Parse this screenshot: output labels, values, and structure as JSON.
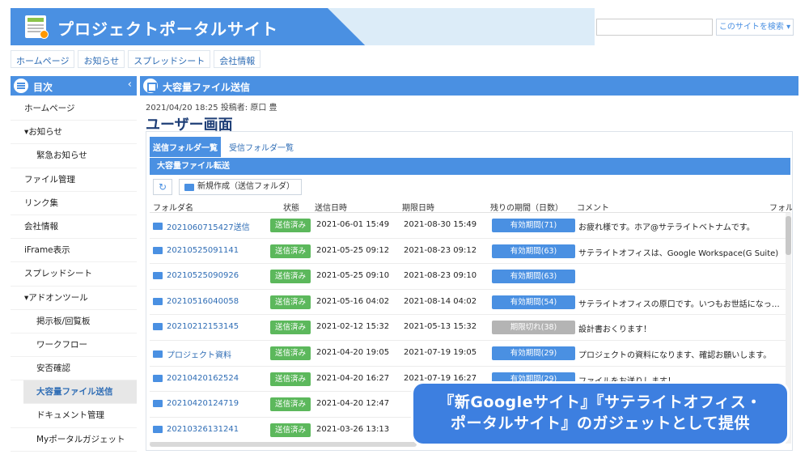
{
  "header": {
    "site_title": "プロジェクトポータルサイト",
    "search_placeholder": "",
    "search_button": "このサイトを検索 ▾",
    "colors": {
      "primary": "#4a90e2",
      "banner_light": "#dcecf8"
    }
  },
  "topnav": [
    "ホームページ",
    "お知らせ",
    "スプレッドシート",
    "会社情報"
  ],
  "sidebar": {
    "title": "目次",
    "collapse_glyph": "‹",
    "items": [
      {
        "label": "ホームページ",
        "level": 0
      },
      {
        "label": "▾お知らせ",
        "level": 0
      },
      {
        "label": "緊急お知らせ",
        "level": 1
      },
      {
        "label": "ファイル管理",
        "level": 0
      },
      {
        "label": "リンク集",
        "level": 0
      },
      {
        "label": "会社情報",
        "level": 0
      },
      {
        "label": "iFrame表示",
        "level": 0
      },
      {
        "label": "スプレッドシート",
        "level": 0
      },
      {
        "label": "▾アドオンツール",
        "level": 0
      },
      {
        "label": "掲示板/回覧板",
        "level": 1
      },
      {
        "label": "ワークフロー",
        "level": 1
      },
      {
        "label": "安否確認",
        "level": 1
      },
      {
        "label": "大容量ファイル送信",
        "level": 1,
        "active": true
      },
      {
        "label": "ドキュメント管理",
        "level": 1
      },
      {
        "label": "Myポータルガジェット",
        "level": 1
      }
    ]
  },
  "main": {
    "title": "大容量ファイル送信",
    "meta": "2021/04/20 18:25 投稿者: 原口 豊",
    "heading": "ユーザー画面",
    "tabs": [
      {
        "label": "送信フォルダ一覧",
        "active": true
      },
      {
        "label": "受信フォルダ一覧",
        "active": false
      }
    ],
    "subhead": "大容量ファイル転送",
    "refresh_glyph": "↻",
    "new_button": "新規作成（送信フォルダ）",
    "columns": {
      "folder": "フォルダ名",
      "status": "状態",
      "sent": "送信日時",
      "limit": "期限日時",
      "remaining": "残りの期間（日数）",
      "comment": "コメント",
      "extra": "フォル"
    },
    "rows": [
      {
        "folder": "20210607154​27送信",
        "status": "送信済み",
        "sent": "2021-06-01 15:49",
        "limit": "2021-08-30 15:49",
        "period": "有効期間(71)",
        "expired": false,
        "comment": "お疲れ様です。ホア@サテライトベトナムです。"
      },
      {
        "folder": "20210525091141",
        "status": "送信済み",
        "sent": "2021-05-25 09:12",
        "limit": "2021-08-23 09:12",
        "period": "有効期間(63)",
        "expired": false,
        "comment": "サテライトオフィスは、Google Workspace(G Suite) …"
      },
      {
        "folder": "20210525090926",
        "status": "送信済み",
        "sent": "2021-05-25 09:10",
        "limit": "2021-08-23 09:10",
        "period": "有効期間(63)",
        "expired": false,
        "comment": ""
      },
      {
        "folder": "20210516040058",
        "status": "送信済み",
        "sent": "2021-05-16 04:02",
        "limit": "2021-08-14 04:02",
        "period": "有効期間(54)",
        "expired": false,
        "comment": "サテライトオフィスの原口です。いつもお世話になっ…"
      },
      {
        "folder": "20210212153145",
        "status": "送信済み",
        "sent": "2021-02-12 15:32",
        "limit": "2021-05-13 15:32",
        "period": "期限切れ(38)",
        "expired": true,
        "comment": "設計書おくります！"
      },
      {
        "folder": "プロジェクト資料",
        "status": "送信済み",
        "sent": "2021-04-20 19:05",
        "limit": "2021-07-19 19:05",
        "period": "有効期間(29)",
        "expired": false,
        "comment": "プロジェクトの資料になります、確認お願いします。"
      },
      {
        "folder": "20210420162524",
        "status": "送信済み",
        "sent": "2021-04-20 16:27",
        "limit": "2021-07-19 16:27",
        "period": "有効期間(29)",
        "expired": false,
        "comment": "ファイルをお送りします！"
      },
      {
        "folder": "20210420124719",
        "status": "送信済み",
        "sent": "2021-04-20 12:47",
        "limit": "",
        "period": "",
        "expired": false,
        "comment": ""
      },
      {
        "folder": "20210326131241",
        "status": "送信済み",
        "sent": "2021-03-26 13:13",
        "limit": "",
        "period": "",
        "expired": false,
        "comment": ""
      }
    ]
  },
  "callout": {
    "line1": "『新Googleサイト』『サテライトオフィス・",
    "line2": "ポータルサイト』のガジェットとして提供"
  }
}
